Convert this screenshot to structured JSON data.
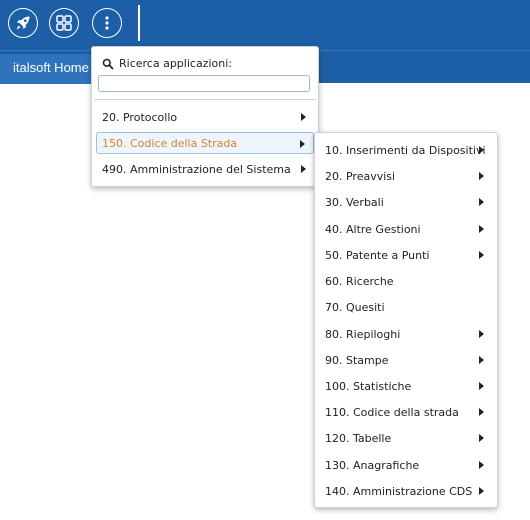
{
  "toolbar": {
    "buttons": [
      {
        "icon": "rocket-icon"
      },
      {
        "icon": "grid-icon"
      },
      {
        "icon": "more-vertical-icon"
      }
    ]
  },
  "tabs": [
    {
      "label": "italsoft Home"
    }
  ],
  "app_menu": {
    "search_label": "Ricerca applicazioni:",
    "search_value": "",
    "items": [
      {
        "label": "20. Protocollo",
        "submenu": true
      },
      {
        "label": "150. Codice della Strada",
        "submenu": true,
        "active": true
      },
      {
        "label": "490. Amministrazione del Sistema",
        "submenu": true
      }
    ]
  },
  "submenu": {
    "items": [
      {
        "label": "10. Inserimenti da Dispositivi",
        "submenu": true
      },
      {
        "label": "20. Preavvisi",
        "submenu": true
      },
      {
        "label": "30. Verbali",
        "submenu": true
      },
      {
        "label": "40. Altre Gestioni",
        "submenu": true
      },
      {
        "label": "50. Patente a Punti",
        "submenu": true
      },
      {
        "label": "60. Ricerche",
        "submenu": false
      },
      {
        "label": "70. Quesiti",
        "submenu": false
      },
      {
        "label": "80. Riepiloghi",
        "submenu": true
      },
      {
        "label": "90. Stampe",
        "submenu": true
      },
      {
        "label": "100. Statistiche",
        "submenu": true
      },
      {
        "label": "110. Codice della strada",
        "submenu": true
      },
      {
        "label": "120. Tabelle",
        "submenu": true
      },
      {
        "label": "130. Anagrafiche",
        "submenu": true
      },
      {
        "label": "140. Amministrazione CDS",
        "submenu": true
      }
    ]
  },
  "colors": {
    "header": "#1d5fa6",
    "tab": "#2f73bb",
    "active_text": "#d9822b"
  }
}
